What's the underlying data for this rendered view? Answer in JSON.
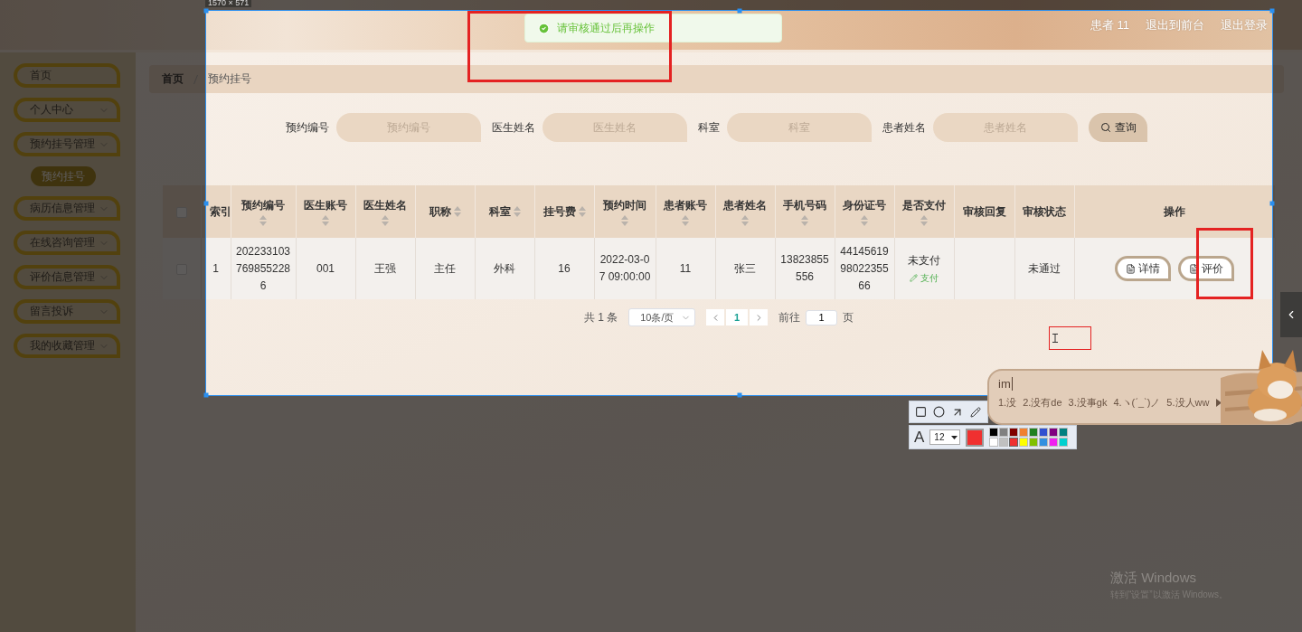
{
  "capture": {
    "size_label": "1570 × 571"
  },
  "header": {
    "user": "患者 11",
    "links": [
      "退出到前台",
      "退出登录"
    ]
  },
  "toast": {
    "kind": "success",
    "text": "请审核通过后再操作"
  },
  "sidebar": {
    "items": [
      {
        "label": "首页",
        "kind": "link"
      },
      {
        "label": "个人中心",
        "kind": "menu"
      },
      {
        "label": "预约挂号管理",
        "kind": "menu",
        "children": [
          {
            "label": "预约挂号",
            "selected": true
          }
        ]
      },
      {
        "label": "病历信息管理",
        "kind": "menu"
      },
      {
        "label": "在线咨询管理",
        "kind": "menu"
      },
      {
        "label": "评价信息管理",
        "kind": "menu"
      },
      {
        "label": "留言投诉",
        "kind": "menu"
      },
      {
        "label": "我的收藏管理",
        "kind": "menu"
      }
    ]
  },
  "breadcrumb": [
    "首页",
    "预约挂号"
  ],
  "search": {
    "fields": [
      {
        "label": "预约编号",
        "placeholder": "预约编号"
      },
      {
        "label": "医生姓名",
        "placeholder": "医生姓名"
      },
      {
        "label": "科室",
        "placeholder": "科室"
      },
      {
        "label": "患者姓名",
        "placeholder": "患者姓名"
      }
    ],
    "button": "查询"
  },
  "table": {
    "select_all": {
      "checked": false
    },
    "columns": [
      {
        "label": "索引",
        "sortable": false
      },
      {
        "label": "预约编号",
        "sortable": true
      },
      {
        "label": "医生账号",
        "sortable": true
      },
      {
        "label": "医生姓名",
        "sortable": true
      },
      {
        "label": "职称",
        "sortable": true
      },
      {
        "label": "科室",
        "sortable": true
      },
      {
        "label": "挂号费",
        "sortable": true
      },
      {
        "label": "预约时间",
        "sortable": true
      },
      {
        "label": "患者账号",
        "sortable": true
      },
      {
        "label": "患者姓名",
        "sortable": true
      },
      {
        "label": "手机号码",
        "sortable": true
      },
      {
        "label": "身份证号",
        "sortable": true
      },
      {
        "label": "是否支付",
        "sortable": true
      },
      {
        "label": "审核回复",
        "sortable": false
      },
      {
        "label": "审核状态",
        "sortable": false
      },
      {
        "label": "操作",
        "sortable": false
      }
    ],
    "rows": [
      {
        "checked": false,
        "cells": [
          {
            "kind": "text",
            "text": "1"
          },
          {
            "kind": "text",
            "text": "2022331037698552286"
          },
          {
            "kind": "text",
            "text": "001"
          },
          {
            "kind": "text",
            "text": "王强"
          },
          {
            "kind": "text",
            "text": "主任"
          },
          {
            "kind": "text",
            "text": "外科"
          },
          {
            "kind": "text",
            "text": "16"
          },
          {
            "kind": "text",
            "text": "2022-03-07 09:00:00"
          },
          {
            "kind": "text",
            "text": "11"
          },
          {
            "kind": "text",
            "text": "张三"
          },
          {
            "kind": "text",
            "text": "13823855556"
          },
          {
            "kind": "text",
            "text": "441456199802235566"
          },
          {
            "kind": "payment",
            "text": "未支付",
            "action": "支付"
          },
          {
            "kind": "empty"
          },
          {
            "kind": "text",
            "text": "未通过"
          }
        ],
        "actions": [
          "详情",
          "评价"
        ]
      }
    ]
  },
  "pagination": {
    "total": "共 1 条",
    "page_size": "10条/页",
    "pages": [
      {
        "label": "1",
        "selected": true
      }
    ],
    "goto_label": "前往",
    "goto_value": "1",
    "goto_suffix": "页"
  },
  "draw_toolbar": {
    "text_tool": "A",
    "font_size": "12",
    "palette": [
      {
        "color": "#000000",
        "selected": false
      },
      {
        "color": "#808080",
        "selected": false
      },
      {
        "color": "#800000",
        "selected": false
      },
      {
        "color": "#f08030",
        "selected": false
      },
      {
        "color": "#208020",
        "selected": false
      },
      {
        "color": "#3050d0",
        "selected": false
      },
      {
        "color": "#800080",
        "selected": false
      },
      {
        "color": "#008080",
        "selected": false
      },
      {
        "color": "#ffffff",
        "selected": false
      },
      {
        "color": "#c0c0c0",
        "selected": false
      },
      {
        "color": "#f03030",
        "selected": true
      },
      {
        "color": "#ffff00",
        "selected": false
      },
      {
        "color": "#80c000",
        "selected": false
      },
      {
        "color": "#3090e0",
        "selected": false
      },
      {
        "color": "#f020f0",
        "selected": false
      },
      {
        "color": "#00d0d0",
        "selected": false
      }
    ]
  },
  "ime": {
    "input": "im",
    "candidates": [
      "1.没",
      "2.没有de",
      "3.没事gk",
      "4.ヽ(ˊ_ˋ)ノ",
      "5.没人ww"
    ]
  },
  "system": {
    "activation_title": "激活 Windows",
    "activation_hint": "转到“设置”以激活 Windows。"
  }
}
